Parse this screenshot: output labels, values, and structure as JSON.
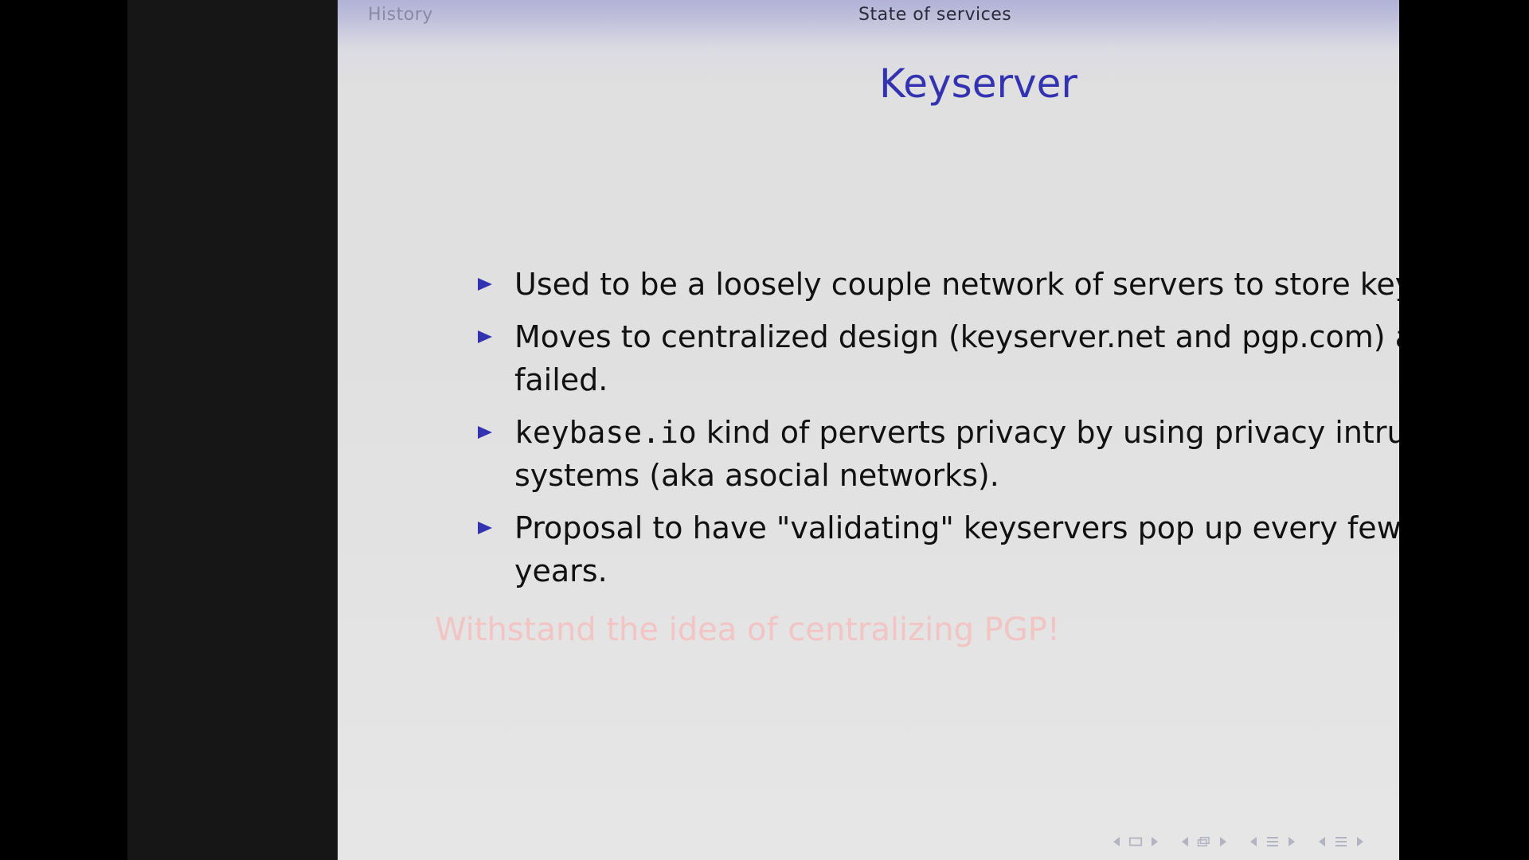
{
  "header": {
    "section_left": "History",
    "section_right": "State of services"
  },
  "slide": {
    "title": "Keyserver",
    "bullets": [
      {
        "line1": "Used to be a loosely couple network of servers to store keys.",
        "line2": ""
      },
      {
        "line1": "Moves to centralized design (keyserver.net and pgp.com) and",
        "line2": "failed."
      },
      {
        "mono": "keybase.io",
        "line1": " kind of perverts privacy by using privacy intruding",
        "line2": "systems (aka asocial networks)."
      },
      {
        "line1": "Proposal to have \"validating\" keyservers pop up every few",
        "line2": "years."
      }
    ],
    "alert": "Withstand the idea of centralizing PGP!"
  },
  "navigation": {
    "icons": [
      "nav-left-arrow-icon",
      "frame-icon",
      "nav-right-arrow-icon",
      "nav-left-arrow-icon",
      "subsection-icon",
      "nav-right-arrow-icon",
      "nav-left-arrow-icon",
      "section-icon",
      "nav-right-arrow-icon",
      "nav-left-arrow-icon",
      "document-icon",
      "nav-right-arrow-icon"
    ]
  },
  "colors": {
    "title": "#3333b2",
    "bullet": "#3333b2",
    "alert": "#f2c4c4",
    "background": "#000000"
  }
}
